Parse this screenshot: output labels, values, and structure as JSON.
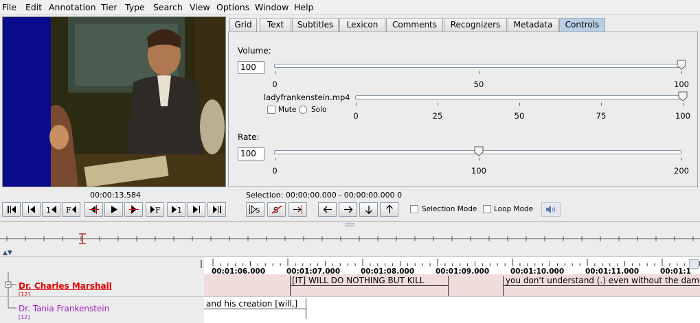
{
  "menu": [
    "File",
    "Edit",
    "Annotation",
    "Tier",
    "Type",
    "Search",
    "View",
    "Options",
    "Window",
    "Help"
  ],
  "tabs": [
    "Grid",
    "Text",
    "Subtitles",
    "Lexicon",
    "Comments",
    "Recognizers",
    "Metadata",
    "Controls"
  ],
  "active_tab": "Controls",
  "controls": {
    "volume_label": "Volume:",
    "volume_value": "100",
    "volume_ticks": [
      "0",
      "50",
      "100"
    ],
    "media_file": "ladyfrankenstein.mp4",
    "media_ticks": [
      "0",
      "25",
      "50",
      "75",
      "100"
    ],
    "mute_label": "Mute",
    "solo_label": "Solo",
    "rate_label": "Rate:",
    "rate_value": "100",
    "rate_ticks": [
      "0",
      "100",
      "200"
    ]
  },
  "levels": {
    "volume": 100,
    "media_volume": 100,
    "rate": 100,
    "rate_max": 200
  },
  "player": {
    "current_time": "00:00:13.584",
    "selection": "Selection: 00:00:00.000 - 00:00:00.000  0",
    "selection_mode_label": "Selection Mode",
    "loop_mode_label": "Loop Mode"
  },
  "timeline": {
    "times": [
      "00:01:06.000",
      "00:01:07.000",
      "00:01:08.000",
      "00:01:09.000",
      "00:01:10.000",
      "00:01:11.000",
      "00:01:1"
    ],
    "tiers": [
      {
        "name": "Dr. Charles Marshall",
        "count": "[12]",
        "color": "#e00000"
      },
      {
        "name": "Dr. Tania Frankenstein",
        "count": "[12]",
        "color": "#a020c0"
      }
    ],
    "annotations_t1": [
      "[IT] WILL DO NOTHING BUT KILL",
      "you don't understand (.) even without the damag"
    ],
    "annotations_t2": [
      "and his creation [will,]"
    ]
  },
  "colors": {
    "tab_active": "#b8cfe5",
    "tier_bg": "#f1dcdc",
    "crosshair": "#cc2222"
  }
}
